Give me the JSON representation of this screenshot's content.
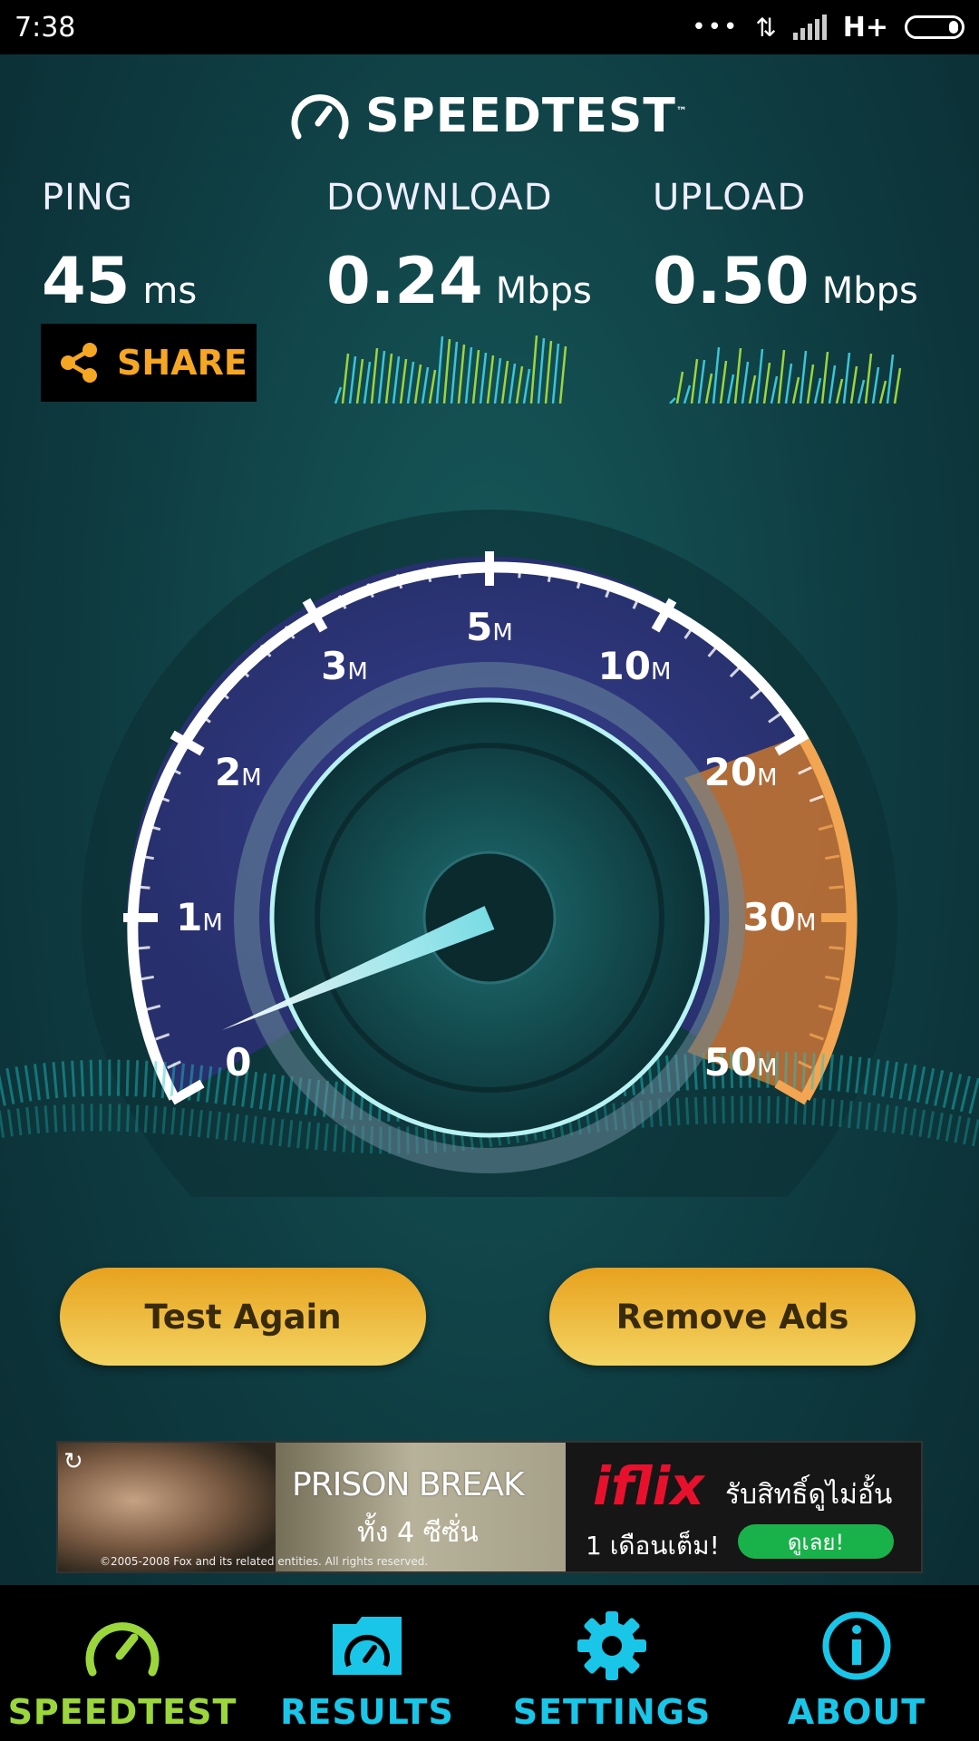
{
  "status_bar": {
    "time": "7:38",
    "network": "H+"
  },
  "app": {
    "title": "SPEEDTEST",
    "trademark": "™"
  },
  "metrics": {
    "ping": {
      "label": "PING",
      "value": "45",
      "unit": "ms"
    },
    "download": {
      "label": "DOWNLOAD",
      "value": "0.24",
      "unit": "Mbps"
    },
    "upload": {
      "label": "UPLOAD",
      "value": "0.50",
      "unit": "Mbps"
    }
  },
  "share_label": "SHARE",
  "gauge": {
    "tick_labels": [
      {
        "value": "0",
        "suffix": ""
      },
      {
        "value": "1",
        "suffix": "M"
      },
      {
        "value": "2",
        "suffix": "M"
      },
      {
        "value": "3",
        "suffix": "M"
      },
      {
        "value": "5",
        "suffix": "M"
      },
      {
        "value": "10",
        "suffix": "M"
      },
      {
        "value": "20",
        "suffix": "M"
      },
      {
        "value": "30",
        "suffix": "M"
      },
      {
        "value": "50",
        "suffix": "M"
      }
    ],
    "needle_value_mbps": 0.24
  },
  "buttons": {
    "test_again": "Test Again",
    "remove_ads": "Remove Ads"
  },
  "ad": {
    "left_title": "PRISON BREAK",
    "left_subtitle": "ทั้ง 4 ซีซั่น",
    "left_copyright": "©2005-2008 Fox and its related entities. All rights reserved.",
    "right_brand": "iflix",
    "right_line1": "รับสิทธิ์ดูไม่อั้น",
    "right_line2": "1 เดือนเต็ม!",
    "right_cta": "ดูเลย!"
  },
  "nav": [
    {
      "label": "SPEEDTEST",
      "icon": "speedometer-icon",
      "active": true
    },
    {
      "label": "RESULTS",
      "icon": "folder-gauge-icon",
      "active": false
    },
    {
      "label": "SETTINGS",
      "icon": "gear-icon",
      "active": false
    },
    {
      "label": "ABOUT",
      "icon": "info-icon",
      "active": false
    }
  ],
  "colors": {
    "accent_green": "#9bd63c",
    "accent_cyan": "#19c6e8",
    "button_gold": "#e8a21e",
    "share_orange": "#f5a623"
  }
}
